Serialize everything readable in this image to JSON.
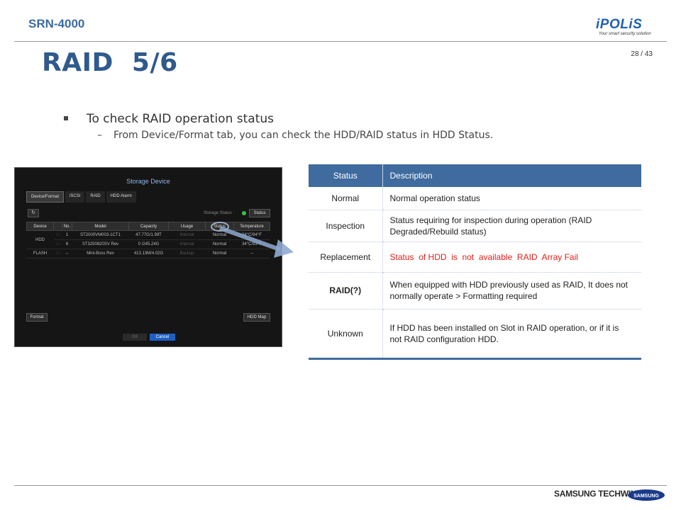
{
  "header": {
    "model": "SRN-4000",
    "page_number": "28 / 43",
    "title": "RAID  5/6",
    "logo_main": "iPOLiS",
    "logo_tagline": "Your smart security solution"
  },
  "bullets": {
    "main": "To check RAID operation status",
    "sub": "From Device/Format tab, you can check the HDD/RAID status in HDD Status."
  },
  "screenshot": {
    "window_title": "Storage Device",
    "tabs": [
      "Device/Format",
      "iSCSI",
      "RAID",
      "HDD Alarm"
    ],
    "status_label": "Storage Status :",
    "status_button": "Status",
    "columns": [
      "Device",
      "",
      "No.",
      "Model",
      "Capacity",
      "Usage",
      "Status",
      "Temperature"
    ],
    "rows": [
      {
        "device": "HDD",
        "no": "1",
        "model": "ST2000VM003-1CT1",
        "capacity": "47.77G/1.99T",
        "usage": "Internal",
        "status": "Normal",
        "temp": "34°C/94°F"
      },
      {
        "device": "",
        "no": "6",
        "model": "ST3250820SV Rev",
        "capacity": "0 /245.24G",
        "usage": "Internal",
        "status": "Normal",
        "temp": "34°C/93°F"
      },
      {
        "device": "FLASH",
        "no": "--",
        "model": "Mini-Boss Rev",
        "capacity": "413.13M/4.02G",
        "usage": "Backup",
        "status": "Normal",
        "temp": "--"
      }
    ],
    "format_button": "Format",
    "hdd_map_button": "HDD Map",
    "ok_button": "OK",
    "cancel_button": "Cancel"
  },
  "status_table": {
    "headers": [
      "Status",
      "Description"
    ],
    "rows": [
      {
        "status": "Normal",
        "description": "Normal operation status"
      },
      {
        "status": "Inspection",
        "description": "Status requiring for inspection during operation (RAID Degraded/Rebuild status)"
      },
      {
        "status": "Replacement",
        "description": "Status  of HDD  is  not  available  RAID  Array Fail"
      },
      {
        "status": "RAID(?)",
        "description": "When equipped with HDD previously used as RAID, It does not normally operate > Formatting required"
      },
      {
        "status": "Unknown",
        "description": "If HDD has been installed on Slot in RAID operation, or if it is not RAID configuration HDD."
      }
    ]
  },
  "footer": {
    "company": "SAMSUNG TECHWIN",
    "brand": "SAMSUNG"
  },
  "colors": {
    "title_blue": "#2f5a8c",
    "table_header": "#3f6b9f",
    "alert_red": "#e0201b"
  }
}
